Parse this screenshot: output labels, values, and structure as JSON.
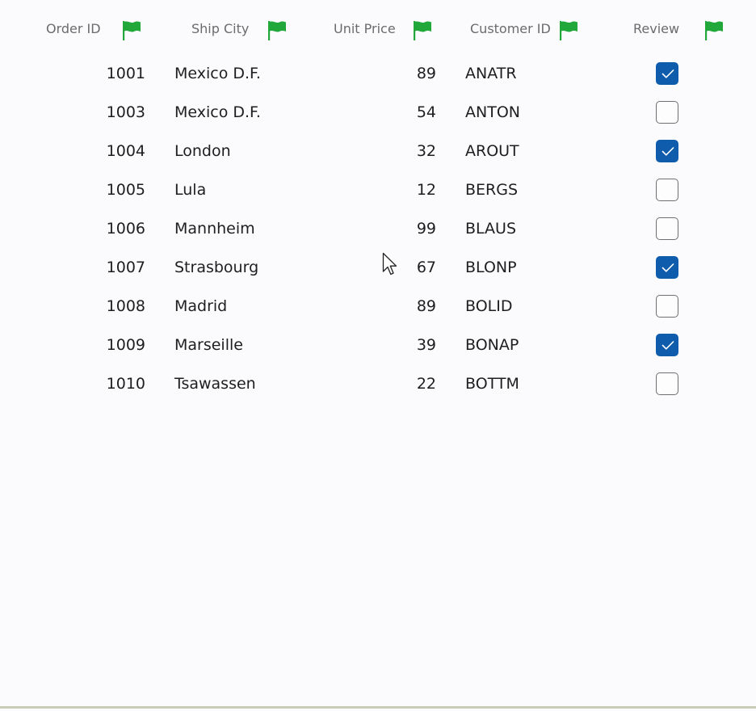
{
  "columns": [
    {
      "label": "Order ID"
    },
    {
      "label": "Ship City"
    },
    {
      "label": "Unit Price"
    },
    {
      "label": "Customer ID"
    },
    {
      "label": "Review"
    }
  ],
  "icons": {
    "header_filter": "flag-icon",
    "pointer": "mouse-cursor-icon"
  },
  "colors": {
    "flag": "#22a83a",
    "checkbox_checked": "#0f5cad"
  },
  "rows": [
    {
      "order_id": "1001",
      "ship_city": "Mexico D.F.",
      "unit_price": "89",
      "customer_id": "ANATR",
      "review": true
    },
    {
      "order_id": "1003",
      "ship_city": "Mexico D.F.",
      "unit_price": "54",
      "customer_id": "ANTON",
      "review": false
    },
    {
      "order_id": "1004",
      "ship_city": "London",
      "unit_price": "32",
      "customer_id": "AROUT",
      "review": true
    },
    {
      "order_id": "1005",
      "ship_city": "Lula",
      "unit_price": "12",
      "customer_id": "BERGS",
      "review": false
    },
    {
      "order_id": "1006",
      "ship_city": "Mannheim",
      "unit_price": "99",
      "customer_id": "BLAUS",
      "review": false
    },
    {
      "order_id": "1007",
      "ship_city": "Strasbourg",
      "unit_price": "67",
      "customer_id": "BLONP",
      "review": true
    },
    {
      "order_id": "1008",
      "ship_city": "Madrid",
      "unit_price": "89",
      "customer_id": "BOLID",
      "review": false
    },
    {
      "order_id": "1009",
      "ship_city": "Marseille",
      "unit_price": "39",
      "customer_id": "BONAP",
      "review": true
    },
    {
      "order_id": "1010",
      "ship_city": "Tsawassen",
      "unit_price": "22",
      "customer_id": "BOTTM",
      "review": false
    }
  ]
}
